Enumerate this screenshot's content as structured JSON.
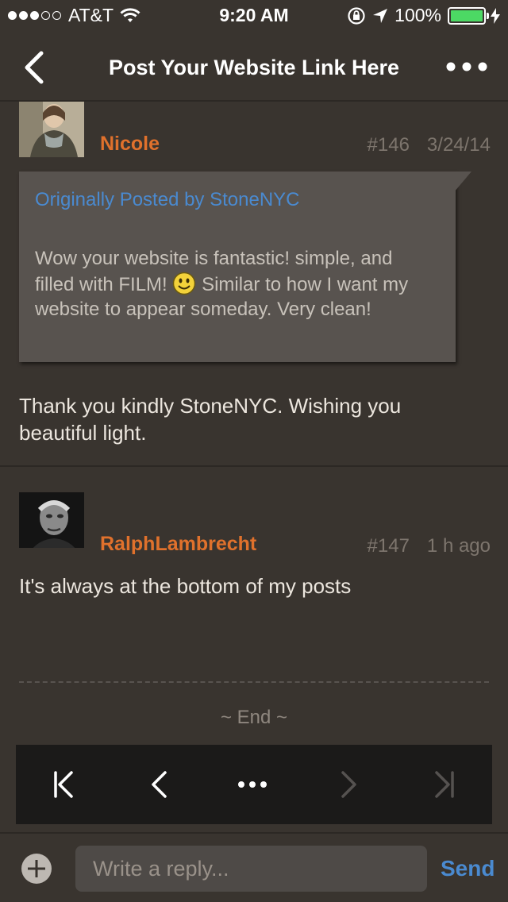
{
  "status_bar": {
    "carrier": "AT&T",
    "time": "9:20 AM",
    "battery": "100%",
    "signal_bars_filled": 3,
    "signal_bars_total": 5,
    "battery_level": 1.0,
    "battery_color": "#4cd964"
  },
  "nav": {
    "title": "Post Your Website Link Here",
    "back_icon": "chevron-left-icon",
    "more_icon": "more-dots-icon"
  },
  "posts": [
    {
      "username": "Nicole",
      "number": "#146",
      "date": "3/24/14",
      "quote": {
        "by": "Originally Posted by StoneNYC",
        "text_before": "Wow your website is fantastic! simple, and filled with FILM!",
        "text_after": "Similar to how I want my website to appear someday. Very clean!"
      },
      "body": "Thank you kindly StoneNYC. Wishing you beautiful light."
    },
    {
      "username": "RalphLambrecht",
      "number": "#147",
      "date": "1 h ago",
      "body": "It's always at the bottom of my posts"
    }
  ],
  "end_label": "~ End ~",
  "pager": {
    "icons": [
      "first-page-icon",
      "previous-page-icon",
      "page-menu-icon",
      "next-page-icon",
      "last-page-icon"
    ]
  },
  "reply": {
    "placeholder": "Write a reply...",
    "send_label": "Send"
  },
  "colors": {
    "accent_username": "#e0712c",
    "link_blue": "#4a8ad0",
    "background": "#39342f"
  }
}
